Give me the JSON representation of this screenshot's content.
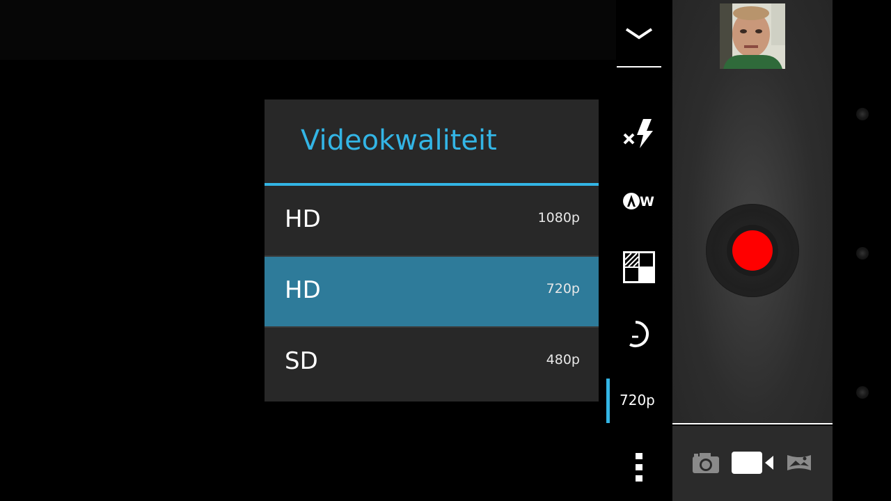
{
  "dialog": {
    "title": "Videokwaliteit",
    "options": [
      {
        "label": "HD",
        "resolution": "1080p",
        "selected": false
      },
      {
        "label": "HD",
        "resolution": "720p",
        "selected": true
      },
      {
        "label": "SD",
        "resolution": "480p",
        "selected": false
      }
    ]
  },
  "settings": {
    "current_resolution": "720p",
    "icons": [
      "chevron-down-icon",
      "flash-off-icon",
      "auto-white-balance-icon",
      "color-effect-icon",
      "timer-icon",
      "video-quality-setting",
      "more-options-icon"
    ]
  },
  "modes": {
    "active": "video",
    "items": [
      "camera-icon",
      "video-camera-icon",
      "panorama-icon"
    ]
  },
  "colors": {
    "accent": "#33b5e5",
    "selected_row": "#2e7b9a",
    "record": "#ff0000"
  }
}
